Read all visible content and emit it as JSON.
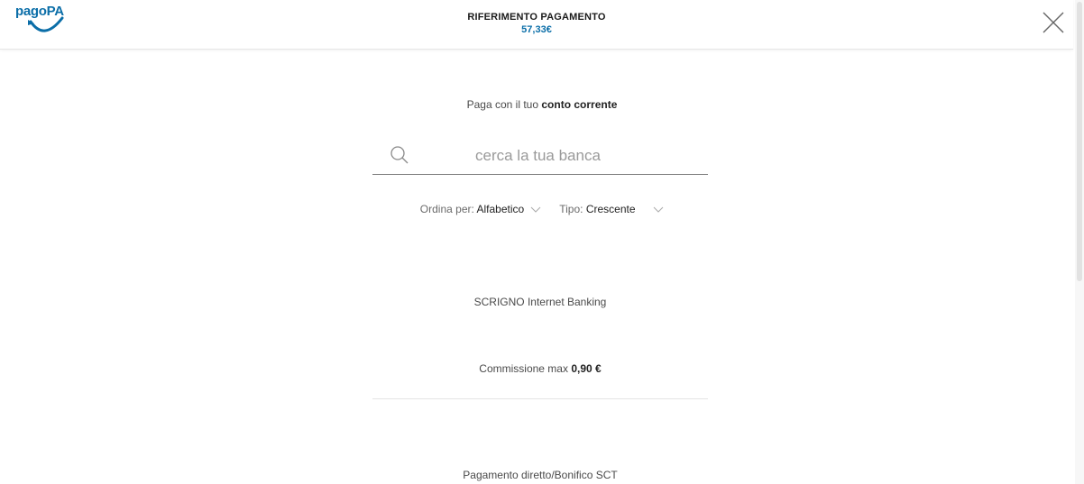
{
  "header": {
    "logo_text": "pagoPA",
    "title": "RIFERIMENTO PAGAMENTO",
    "amount": "57,33€",
    "close_icon": "close-icon"
  },
  "main": {
    "intro_prefix": "Paga con il tuo",
    "intro_bold": "conto corrente",
    "search": {
      "placeholder": "cerca la tua banca",
      "value": "",
      "icon": "search-icon"
    },
    "sort": {
      "order_label": "Ordina per:",
      "order_value": "Alfabetico",
      "type_label": "Tipo:",
      "type_value": "Crescente"
    },
    "banks": [
      {
        "name": "SCRIGNO Internet Banking",
        "fee_label": "Commissione max",
        "fee_value": "0,90 €"
      },
      {
        "name": "Pagamento diretto/Bonifico SCT"
      }
    ]
  },
  "colors": {
    "brand_blue": "#0b6ea8",
    "text_dark": "#222222",
    "text_muted": "#4a4a4a"
  }
}
